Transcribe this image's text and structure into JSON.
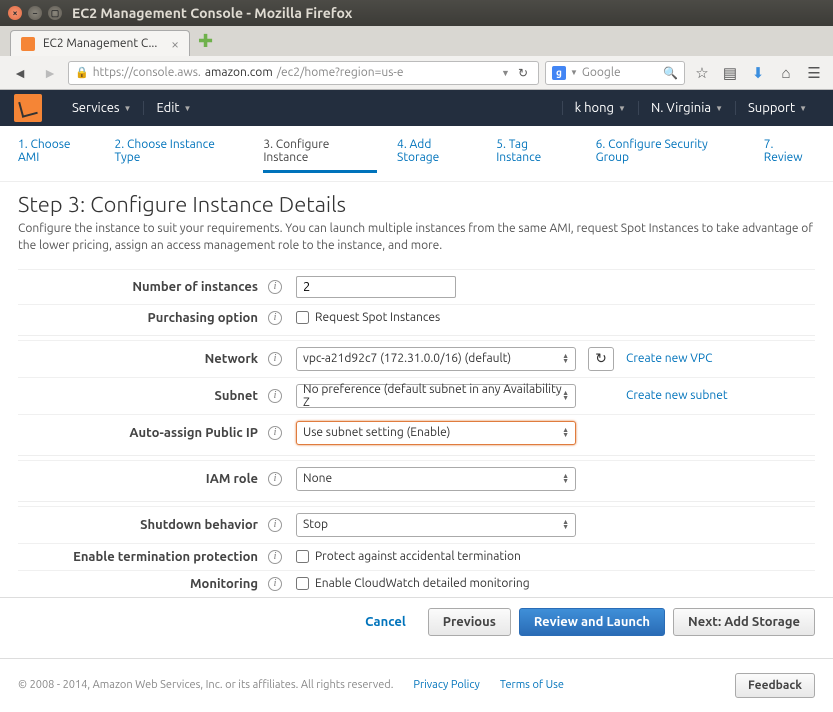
{
  "window": {
    "title": "EC2 Management Console - Mozilla Firefox"
  },
  "browser": {
    "tab_title": "EC2 Management C...",
    "url_prefix": "https://console.aws.",
    "url_domain": "amazon.com",
    "url_path": "/ec2/home?region=us-e",
    "search_placeholder": "Google"
  },
  "aws_header": {
    "services": "Services",
    "edit": "Edit",
    "user": "k hong",
    "region": "N. Virginia",
    "support": "Support"
  },
  "wizard": {
    "steps": [
      "1. Choose AMI",
      "2. Choose Instance Type",
      "3. Configure Instance",
      "4. Add Storage",
      "5. Tag Instance",
      "6. Configure Security Group",
      "7. Review"
    ],
    "active_index": 2
  },
  "page": {
    "title": "Step 3: Configure Instance Details",
    "desc": "Configure the instance to suit your requirements. You can launch multiple instances from the same AMI, request Spot Instances to take advantage of the lower pricing, assign an access management role to the instance, and more."
  },
  "form": {
    "num_instances_label": "Number of instances",
    "num_instances_value": "2",
    "purchasing_label": "Purchasing option",
    "purchasing_checkbox": "Request Spot Instances",
    "network_label": "Network",
    "network_value": "vpc-a21d92c7 (172.31.0.0/16) (default)",
    "create_vpc": "Create new VPC",
    "subnet_label": "Subnet",
    "subnet_value": "No preference (default subnet in any Availability Z",
    "create_subnet": "Create new subnet",
    "public_ip_label": "Auto-assign Public IP",
    "public_ip_value": "Use subnet setting (Enable)",
    "iam_label": "IAM role",
    "iam_value": "None",
    "shutdown_label": "Shutdown behavior",
    "shutdown_value": "Stop",
    "termination_label": "Enable termination protection",
    "termination_checkbox": "Protect against accidental termination",
    "monitoring_label": "Monitoring",
    "monitoring_checkbox": "Enable CloudWatch detailed monitoring"
  },
  "buttons": {
    "cancel": "Cancel",
    "previous": "Previous",
    "review": "Review and Launch",
    "next": "Next: Add Storage"
  },
  "footer": {
    "copyright": "© 2008 - 2014, Amazon Web Services, Inc. or its affiliates. All rights reserved.",
    "privacy": "Privacy Policy",
    "terms": "Terms of Use",
    "feedback": "Feedback"
  }
}
